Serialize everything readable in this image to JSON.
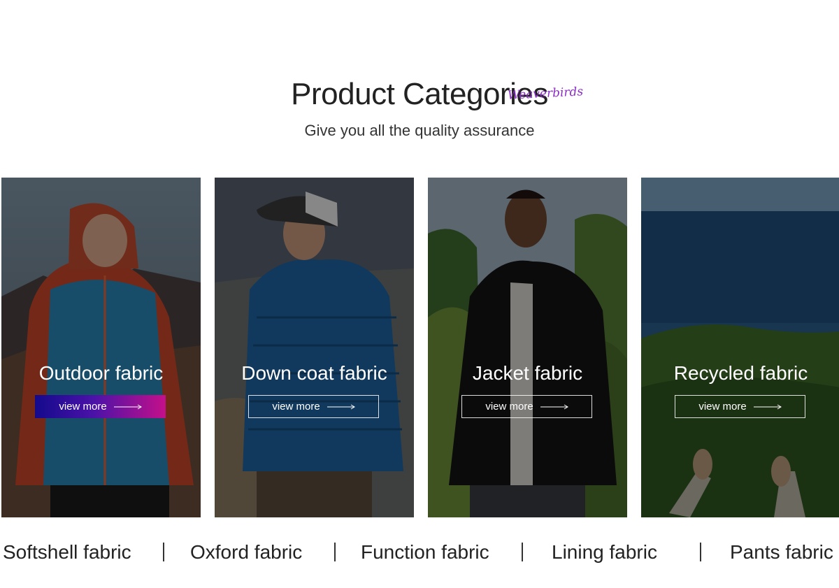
{
  "header": {
    "title": "Product Categories",
    "brand_mark": "Weaverbirds",
    "subtitle": "Give you all the quality assurance"
  },
  "cards": [
    {
      "title": "Outdoor fabric",
      "button": "view more",
      "state": "active"
    },
    {
      "title": "Down coat fabric",
      "button": "view more",
      "state": "default"
    },
    {
      "title": "Jacket fabric",
      "button": "view more",
      "state": "default"
    },
    {
      "title": "Recycled fabric",
      "button": "view more",
      "state": "default"
    }
  ],
  "categories": [
    {
      "label": "Softshell fabric"
    },
    {
      "label": "Oxford fabric"
    },
    {
      "label": "Function fabric"
    },
    {
      "label": "Lining fabric"
    },
    {
      "label": "Pants fabric"
    }
  ],
  "colors": {
    "active_button_start": "#140a8c",
    "active_button_end": "#c4108a",
    "brand_mark": "#8b2bc7"
  },
  "icons": [
    "arrow-right-icon"
  ]
}
